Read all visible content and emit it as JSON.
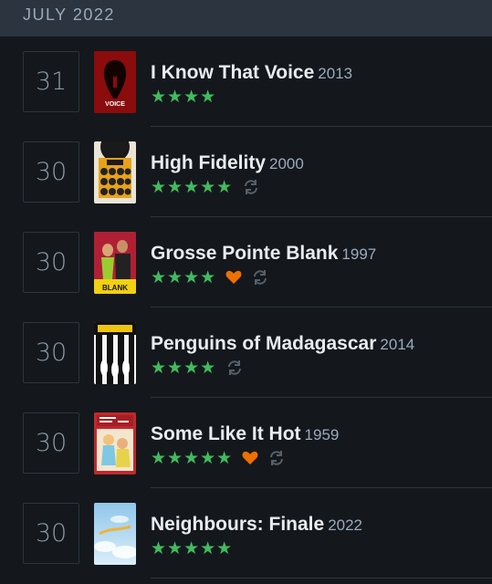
{
  "month_header": "JULY 2022",
  "colors": {
    "star": "#40bc5f",
    "heart": "#ee7000",
    "rewatch": "#56606b"
  },
  "entries": [
    {
      "day": "31",
      "title": "I Know That Voice",
      "year": "2013",
      "stars": "★★★★",
      "liked": false,
      "rewatch": false,
      "poster": "i-know-that-voice-poster"
    },
    {
      "day": "30",
      "title": "High Fidelity",
      "year": "2000",
      "stars": "★★★★★",
      "liked": false,
      "rewatch": true,
      "poster": "high-fidelity-poster"
    },
    {
      "day": "30",
      "title": "Grosse Pointe Blank",
      "year": "1997",
      "stars": "★★★★",
      "liked": true,
      "rewatch": true,
      "poster": "grosse-pointe-blank-poster"
    },
    {
      "day": "30",
      "title": "Penguins of Madagascar",
      "year": "2014",
      "stars": "★★★★",
      "liked": false,
      "rewatch": true,
      "poster": "penguins-of-madagascar-poster"
    },
    {
      "day": "30",
      "title": "Some Like It Hot",
      "year": "1959",
      "stars": "★★★★★",
      "liked": true,
      "rewatch": true,
      "poster": "some-like-it-hot-poster"
    },
    {
      "day": "30",
      "title": "Neighbours: Finale",
      "year": "2022",
      "stars": "★★★★★",
      "liked": false,
      "rewatch": false,
      "poster": "neighbours-finale-poster"
    }
  ],
  "poster_text": {
    "voice": "VOICE",
    "blank": "BLANK"
  }
}
